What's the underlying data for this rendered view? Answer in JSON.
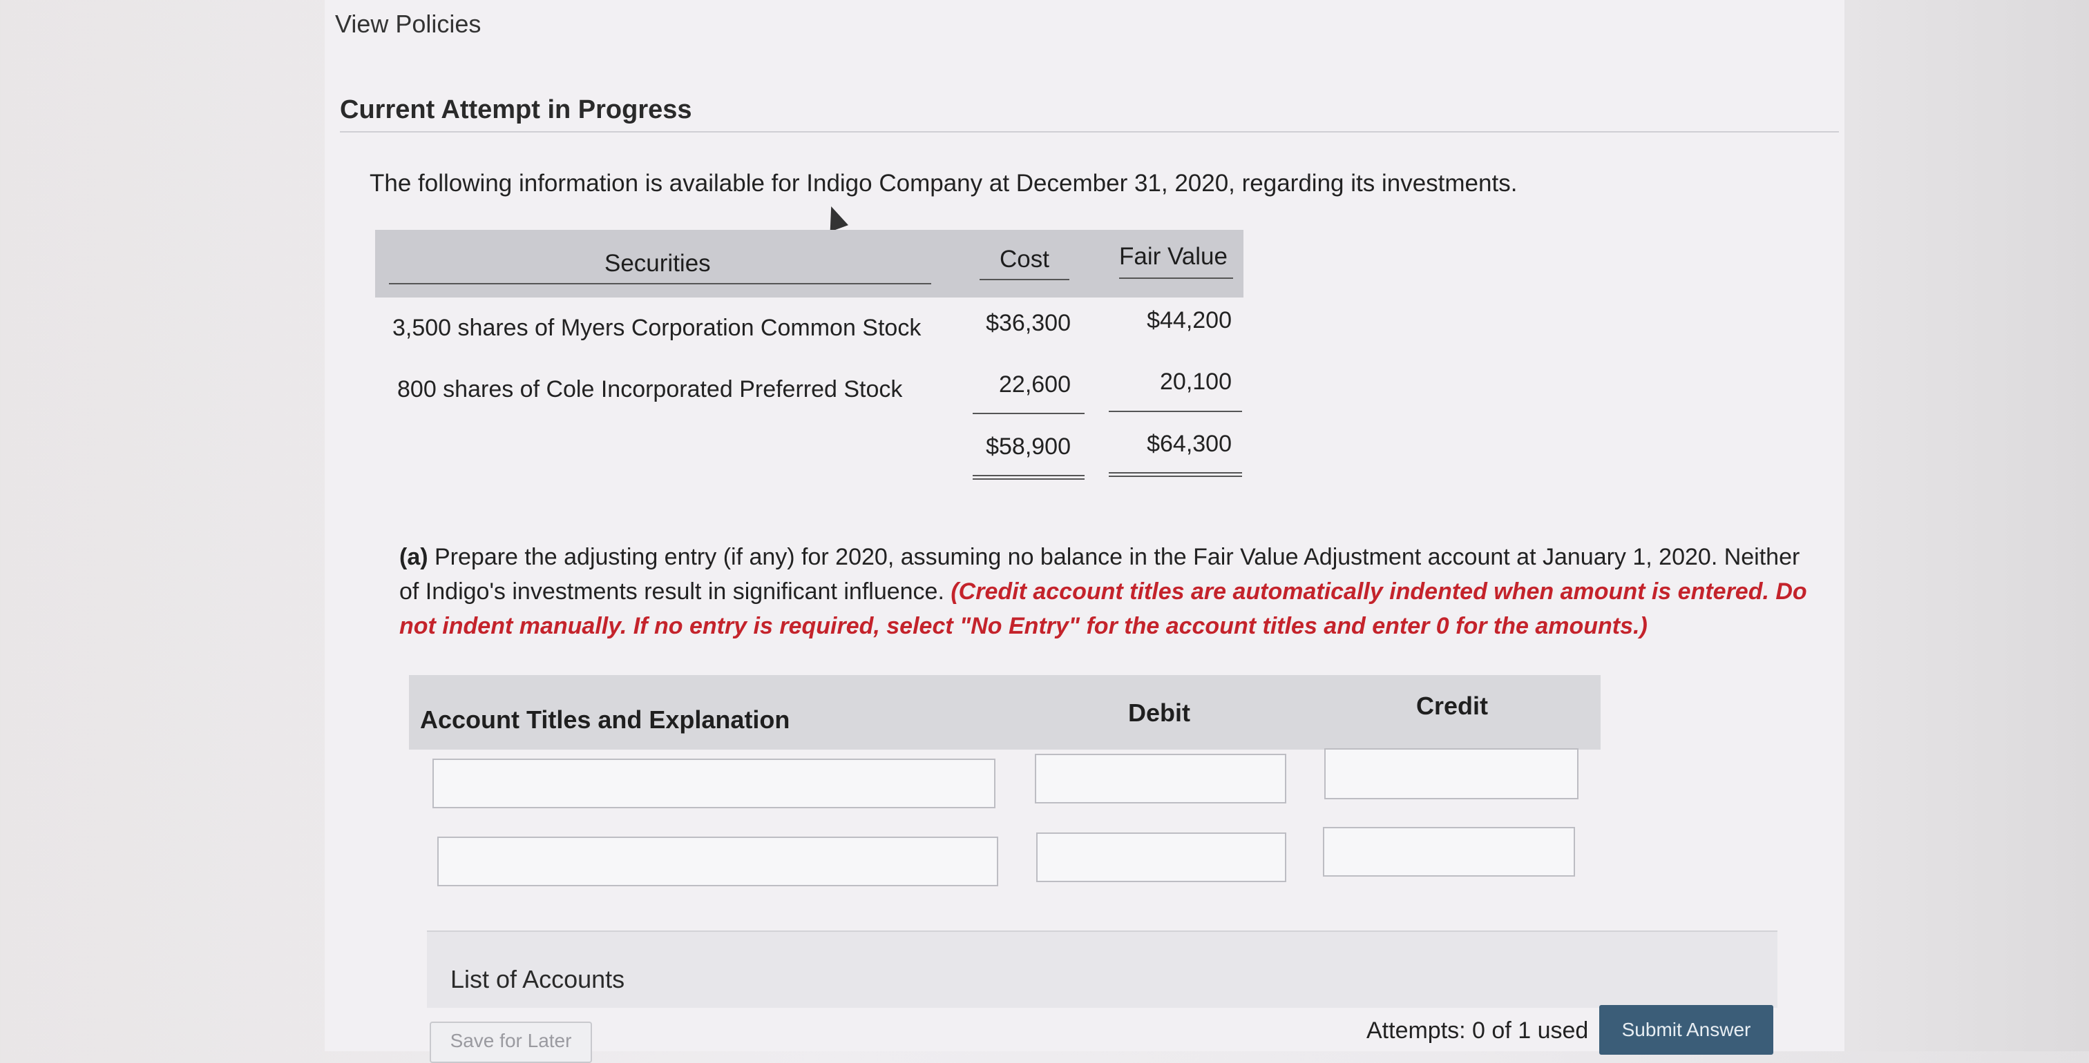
{
  "header": {
    "view_policies": "View Policies",
    "attempt_heading": "Current Attempt in Progress"
  },
  "question": {
    "intro": "The following information is available for Indigo Company at December 31, 2020, regarding its investments."
  },
  "securities_table": {
    "headers": {
      "securities": "Securities",
      "cost": "Cost",
      "fair_value": "Fair Value"
    },
    "rows": [
      {
        "name": "3,500 shares of Myers Corporation Common Stock",
        "cost": "$36,300",
        "fair_value": "$44,200"
      },
      {
        "name": "800 shares of Cole Incorporated Preferred Stock",
        "cost": "22,600",
        "fair_value": "20,100"
      }
    ],
    "totals": {
      "cost": "$58,900",
      "fair_value": "$64,300"
    }
  },
  "part_a": {
    "label": "(a)",
    "text": " Prepare the adjusting entry (if any) for 2020, assuming no balance in the Fair Value Adjustment account at January 1, 2020. Neither of Indigo's investments result in significant influence. ",
    "instruction": "(Credit account titles are automatically indented when amount is entered. Do not indent manually. If no entry is required, select \"No Entry\" for the account titles and enter 0 for the amounts.)"
  },
  "journal": {
    "headers": {
      "account": "Account Titles and Explanation",
      "debit": "Debit",
      "credit": "Credit"
    },
    "rows": [
      {
        "account": "",
        "debit": "",
        "credit": ""
      },
      {
        "account": "",
        "debit": "",
        "credit": ""
      }
    ]
  },
  "footer": {
    "list_of_accounts": "List of Accounts",
    "save_for_later": "Save for Later",
    "attempts": "Attempts: 0 of 1 used",
    "submit": "Submit Answer"
  },
  "colors": {
    "submit_bg": "#3b5d78",
    "instruction_red": "#c4232b"
  }
}
